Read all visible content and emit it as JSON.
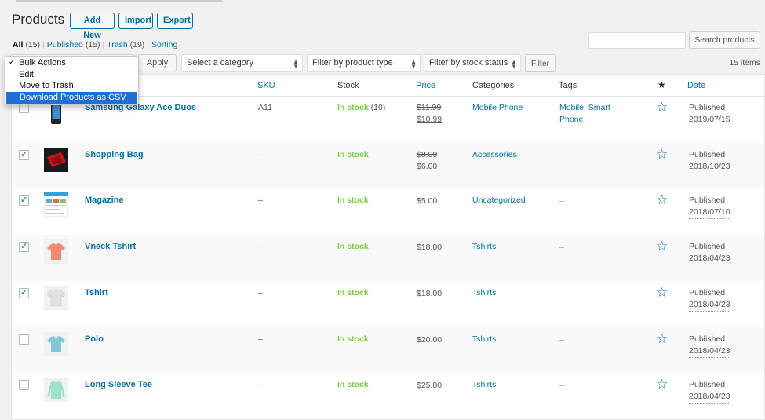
{
  "header": {
    "title": "Products",
    "add_new": "Add New",
    "import": "Import",
    "export": "Export"
  },
  "views": {
    "all": "All",
    "all_count": "(15)",
    "published": "Published",
    "published_count": "(15)",
    "trash": "Trash",
    "trash_count": "(19)",
    "sorting": "Sorting",
    "separator": "|"
  },
  "search": {
    "placeholder": "",
    "button": "Search products"
  },
  "bulk": {
    "apply": "Apply",
    "options": [
      "Bulk Actions",
      "Edit",
      "Move to Trash",
      "Download Products as CSV"
    ],
    "selected_mark": "✓"
  },
  "filters": {
    "category": "Select a category",
    "product_type": "Filter by product type",
    "stock_status": "Filter by stock status",
    "filter_button": "Filter"
  },
  "items_count": "15 items",
  "table": {
    "headers": {
      "sku": "SKU",
      "stock": "Stock",
      "price": "Price",
      "categories": "Categories",
      "tags": "Tags",
      "featured": "★",
      "date": "Date"
    },
    "rows": [
      {
        "name": "Samsung Galaxy Ace Duos",
        "sku": "A11",
        "stock": "In stock",
        "stock_qty": "(10)",
        "price_old": "$11.99",
        "price_new": "$10.99",
        "category": "Mobile Phone",
        "tags_line1": "Mobile, Smart",
        "tags_line2": "Phone",
        "status": "Published",
        "date": "2019/07/15",
        "checked": false,
        "thumb_icon": "phone-icon"
      },
      {
        "name": "Shopping Bag",
        "sku": "–",
        "stock": "In stock",
        "stock_qty": "",
        "price_old": "$8.00",
        "price_new": "$6.00",
        "category": "Accessories",
        "tags_line1": "–",
        "tags_line2": "",
        "status": "Published",
        "date": "2018/10/23",
        "checked": true,
        "thumb_icon": "bag-icon"
      },
      {
        "name": "Magazine",
        "sku": "–",
        "stock": "In stock",
        "stock_qty": "",
        "price_old": "",
        "price_new": "$5.00",
        "category": "Uncategorized",
        "tags_line1": "–",
        "tags_line2": "",
        "status": "Published",
        "date": "2018/07/10",
        "checked": true,
        "thumb_icon": "magazine-icon"
      },
      {
        "name": "Vneck Tshirt",
        "sku": "–",
        "stock": "In stock",
        "stock_qty": "",
        "price_old": "",
        "price_new": "$18.00",
        "category": "Tshirts",
        "tags_line1": "–",
        "tags_line2": "",
        "status": "Published",
        "date": "2018/04/23",
        "checked": true,
        "thumb_icon": "tshirt-icon"
      },
      {
        "name": "Tshirt",
        "sku": "–",
        "stock": "In stock",
        "stock_qty": "",
        "price_old": "",
        "price_new": "$18.00",
        "category": "Tshirts",
        "tags_line1": "–",
        "tags_line2": "",
        "status": "Published",
        "date": "2018/04/23",
        "checked": true,
        "thumb_icon": "tshirt-icon"
      },
      {
        "name": "Polo",
        "sku": "–",
        "stock": "In stock",
        "stock_qty": "",
        "price_old": "",
        "price_new": "$20.00",
        "category": "Tshirts",
        "tags_line1": "–",
        "tags_line2": "",
        "status": "Published",
        "date": "2018/04/23",
        "checked": false,
        "thumb_icon": "polo-icon"
      },
      {
        "name": "Long Sleeve Tee",
        "sku": "–",
        "stock": "In stock",
        "stock_qty": "",
        "price_old": "",
        "price_new": "$25.00",
        "category": "Tshirts",
        "tags_line1": "–",
        "tags_line2": "",
        "status": "Published",
        "date": "2018/04/23",
        "checked": false,
        "thumb_icon": "long-sleeve-icon"
      }
    ]
  },
  "colors": {
    "link": "#0073aa",
    "in_stock": "#7ad03a",
    "highlight": "#1e6fd9"
  }
}
